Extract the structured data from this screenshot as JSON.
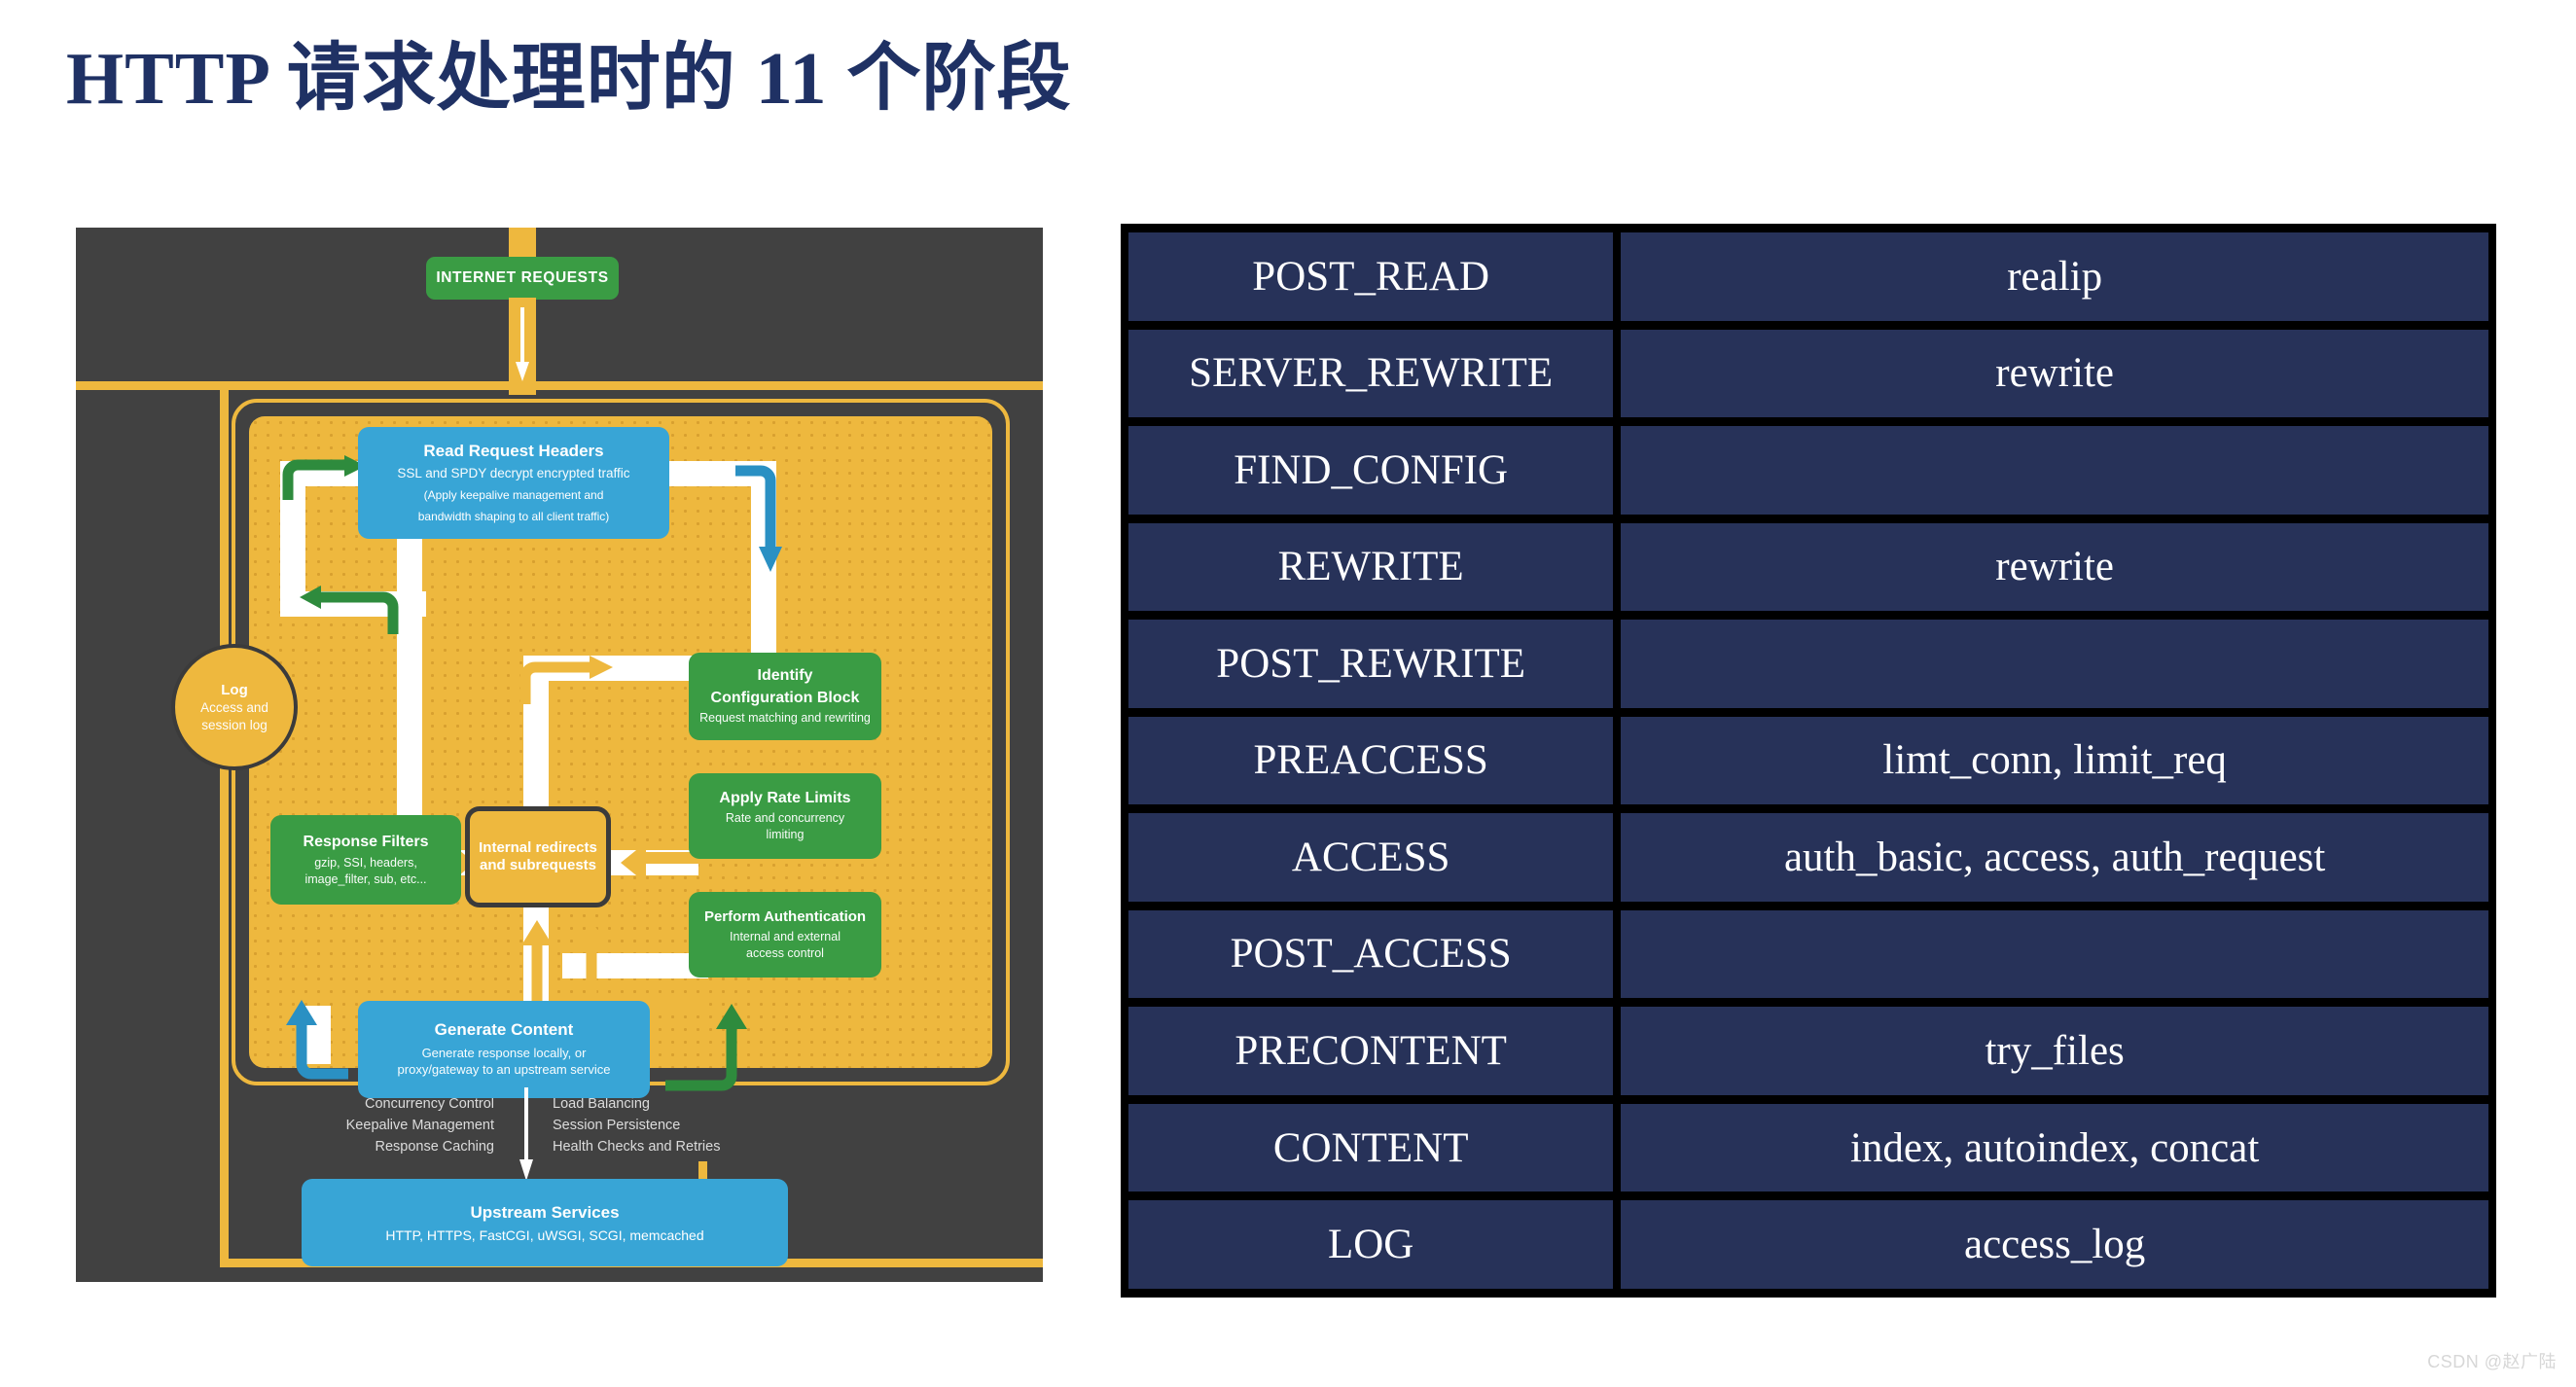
{
  "page": {
    "title": "HTTP 请求处理时的 11 个阶段",
    "watermark": "CSDN @赵广陆",
    "accent_navy": "#1f3164",
    "table_cell_bg": "#273259",
    "diagram_bg": "#414141",
    "diagram_orange": "#eeb83e",
    "diagram_green": "#3a9c44",
    "diagram_blue": "#38a5d6"
  },
  "diagram": {
    "entry_label": "INTERNET REQUESTS",
    "log": {
      "title": "Log",
      "line1": "Access and",
      "line2": "session log"
    },
    "nodes": {
      "read_request_headers": {
        "title": "Read Request Headers",
        "subtitle": "SSL and SPDY decrypt encrypted traffic",
        "note_line1": "(Apply keepalive management and",
        "note_line2": "bandwidth shaping to all client traffic)"
      },
      "identify_configuration_block": {
        "title_line1": "Identify",
        "title_line2": "Configuration Block",
        "subtitle": "Request matching and rewriting"
      },
      "apply_rate_limits": {
        "title": "Apply Rate Limits",
        "subtitle_line1": "Rate and concurrency",
        "subtitle_line2": "limiting"
      },
      "perform_authentication": {
        "title": "Perform Authentication",
        "subtitle_line1": "Internal and external",
        "subtitle_line2": "access control"
      },
      "response_filters": {
        "title": "Response Filters",
        "subtitle_line1": "gzip, SSI, headers,",
        "subtitle_line2": "image_filter, sub, etc..."
      },
      "internal_redirects": {
        "title_line1": "Internal redirects",
        "title_line2": "and subrequests"
      },
      "generate_content": {
        "title": "Generate Content",
        "subtitle_line1": "Generate response locally, or",
        "subtitle_line2": "proxy/gateway to an upstream service"
      },
      "upstream_services": {
        "title": "Upstream Services",
        "subtitle": "HTTP, HTTPS, FastCGI, uWSGI, SCGI, memcached"
      }
    },
    "bottom_notes_left": [
      "Concurrency Control",
      "Keepalive Management",
      "Response Caching"
    ],
    "bottom_notes_right": [
      "Load Balancing",
      "Session Persistence",
      "Health Checks and Retries"
    ]
  },
  "table": {
    "rows": [
      {
        "phase": "POST_READ",
        "directives": "realip"
      },
      {
        "phase": "SERVER_REWRITE",
        "directives": "rewrite"
      },
      {
        "phase": "FIND_CONFIG",
        "directives": ""
      },
      {
        "phase": "REWRITE",
        "directives": "rewrite"
      },
      {
        "phase": "POST_REWRITE",
        "directives": ""
      },
      {
        "phase": "PREACCESS",
        "directives": "limt_conn, limit_req"
      },
      {
        "phase": "ACCESS",
        "directives": "auth_basic, access, auth_request"
      },
      {
        "phase": "POST_ACCESS",
        "directives": ""
      },
      {
        "phase": "PRECONTENT",
        "directives": "try_files"
      },
      {
        "phase": "CONTENT",
        "directives": "index, autoindex, concat"
      },
      {
        "phase": "LOG",
        "directives": "access_log"
      }
    ]
  }
}
